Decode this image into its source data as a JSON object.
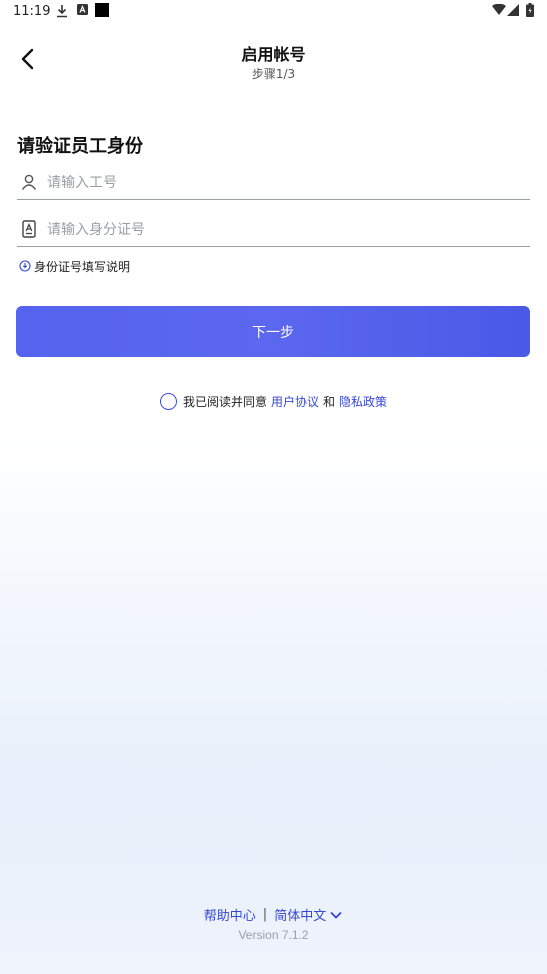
{
  "status_bar": {
    "time": "11:19",
    "icons": [
      "download-icon",
      "a-badge-icon",
      "black-square-icon",
      "wifi-icon",
      "signal-icon",
      "battery-icon"
    ]
  },
  "header": {
    "back_icon": "chevron-left-icon",
    "title": "启用帐号",
    "subtitle": "步骤1/3"
  },
  "form": {
    "section_title": "请验证员工身份",
    "employee_id": {
      "icon": "person-icon",
      "value": "",
      "placeholder": "请输入工号"
    },
    "id_number": {
      "icon": "id-card-icon",
      "value": "",
      "placeholder": "请输入身分证号"
    },
    "hint": {
      "icon": "info-icon",
      "text": "身份证号填写说明"
    }
  },
  "next_button": "下一步",
  "agreement": {
    "checked": false,
    "prefix": "我已阅读并同意",
    "user_agreement": "用户协议",
    "and": "和",
    "privacy_policy": "隐私政策"
  },
  "footer": {
    "help": "帮助中心",
    "separator": "|",
    "language": "简体中文",
    "language_icon": "chevron-down-icon",
    "version": "Version 7.1.2"
  },
  "colors": {
    "accent": "#3447d6",
    "button_start": "#5563ee",
    "button_end": "#4a59e6"
  }
}
